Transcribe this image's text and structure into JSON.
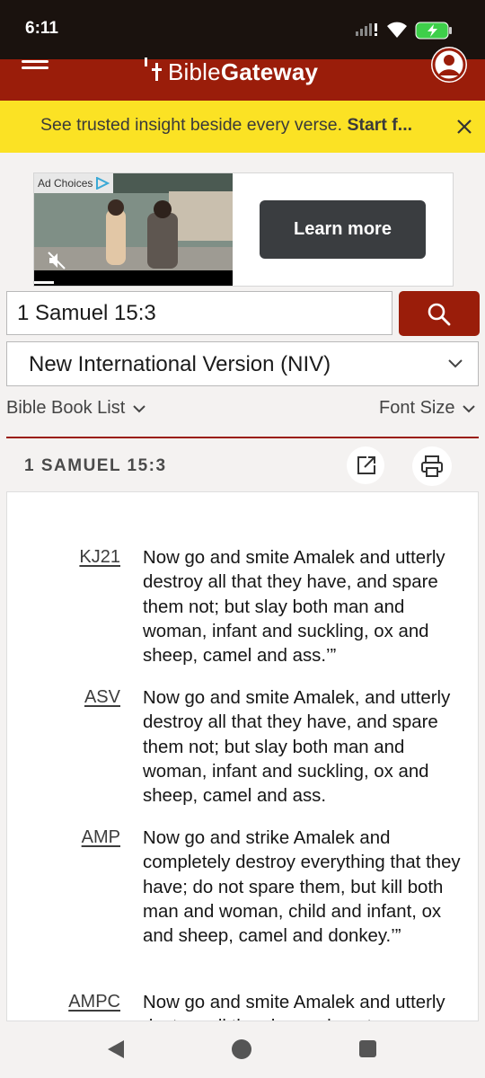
{
  "status_bar": {
    "time": "6:11"
  },
  "header": {
    "logo_text_light": "Bible",
    "logo_text_bold": "Gateway"
  },
  "promo": {
    "text": "See trusted insight beside every verse.",
    "cta": "Start f..."
  },
  "ad": {
    "choices_label": "Ad Choices",
    "button_label": "Learn more"
  },
  "search": {
    "value": "1 Samuel 15:3"
  },
  "version": {
    "selected": "New International Version (NIV)"
  },
  "links": {
    "book_list": "Bible Book List",
    "font_size": "Font Size"
  },
  "passage": {
    "title": "1 SAMUEL 15:3",
    "verses": [
      {
        "abbr": "KJ21",
        "text": "Now go and smite Amalek and utterly destroy all that they have, and spare them not; but slay both man and woman, infant and suckling, ox and sheep, camel and ass.’”"
      },
      {
        "abbr": "ASV",
        "text": "Now go and smite Amalek, and utterly destroy all that they have, and spare them not; but slay both man and woman, infant and suckling, ox and sheep, camel and ass."
      },
      {
        "abbr": "AMP",
        "text": "Now go and strike Amalek and completely destroy everything that they have; do not spare them, but kill both man and woman, child and infant, ox and sheep, camel and donkey.’”"
      },
      {
        "abbr": "AMPC",
        "text": "Now go and smite Amalek and utterly destroy all they have; do not spare them"
      }
    ]
  },
  "colors": {
    "brand_red": "#9a1d0a",
    "promo_yellow": "#fbe224"
  }
}
